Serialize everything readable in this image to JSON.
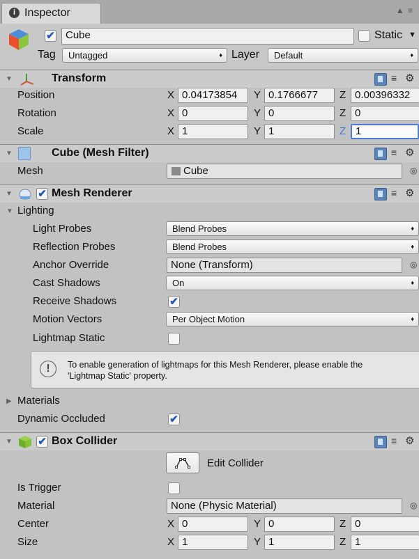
{
  "tab": {
    "title": "Inspector",
    "icon": "info-icon",
    "corner": "▲ ≡"
  },
  "object": {
    "name": "Cube",
    "active": true,
    "static_label": "Static",
    "static": false,
    "tag_label": "Tag",
    "tag": "Untagged",
    "layer_label": "Layer",
    "layer": "Default"
  },
  "transform": {
    "title": "Transform",
    "axes": {
      "x": "X",
      "y": "Y",
      "z": "Z"
    },
    "position_label": "Position",
    "position": {
      "x": "0.04173854",
      "y": "0.1766677",
      "z": "0.00396332"
    },
    "rotation_label": "Rotation",
    "rotation": {
      "x": "0",
      "y": "0",
      "z": "0"
    },
    "scale_label": "Scale",
    "scale": {
      "x": "1",
      "y": "1",
      "z": "1"
    }
  },
  "mesh_filter": {
    "title": "Cube (Mesh Filter)",
    "mesh_label": "Mesh",
    "mesh": "Cube"
  },
  "mesh_renderer": {
    "title": "Mesh Renderer",
    "enabled": true,
    "lighting_label": "Lighting",
    "light_probes_label": "Light Probes",
    "light_probes": "Blend Probes",
    "reflection_probes_label": "Reflection Probes",
    "reflection_probes": "Blend Probes",
    "anchor_override_label": "Anchor Override",
    "anchor_override": "None (Transform)",
    "cast_shadows_label": "Cast Shadows",
    "cast_shadows": "On",
    "receive_shadows_label": "Receive Shadows",
    "receive_shadows": true,
    "motion_vectors_label": "Motion Vectors",
    "motion_vectors": "Per Object Motion",
    "lightmap_static_label": "Lightmap Static",
    "lightmap_static": false,
    "info_line1": "To enable generation of lightmaps for this Mesh Renderer, please enable the",
    "info_line2": "'Lightmap Static' property.",
    "materials_label": "Materials",
    "dynamic_occluded_label": "Dynamic Occluded",
    "dynamic_occluded": true
  },
  "box_collider": {
    "title": "Box Collider",
    "enabled": true,
    "edit_collider_label": "Edit Collider",
    "is_trigger_label": "Is Trigger",
    "is_trigger": false,
    "material_label": "Material",
    "material": "None (Physic Material)",
    "center_label": "Center",
    "center": {
      "x": "0",
      "y": "0",
      "z": "0"
    },
    "size_label": "Size",
    "size": {
      "x": "1",
      "y": "1",
      "z": "1"
    }
  },
  "glyphs": {
    "check": "✔",
    "dropdown_arrow": "♦",
    "picker": "◎",
    "expanded": "▼",
    "collapsed": "▶",
    "gear": "⚙",
    "sliders": "≡"
  },
  "colors": {
    "panel": "#c2c2c2",
    "header": "#cbcbcb",
    "focus": "#4b7dd8",
    "check": "#1f56b8"
  }
}
